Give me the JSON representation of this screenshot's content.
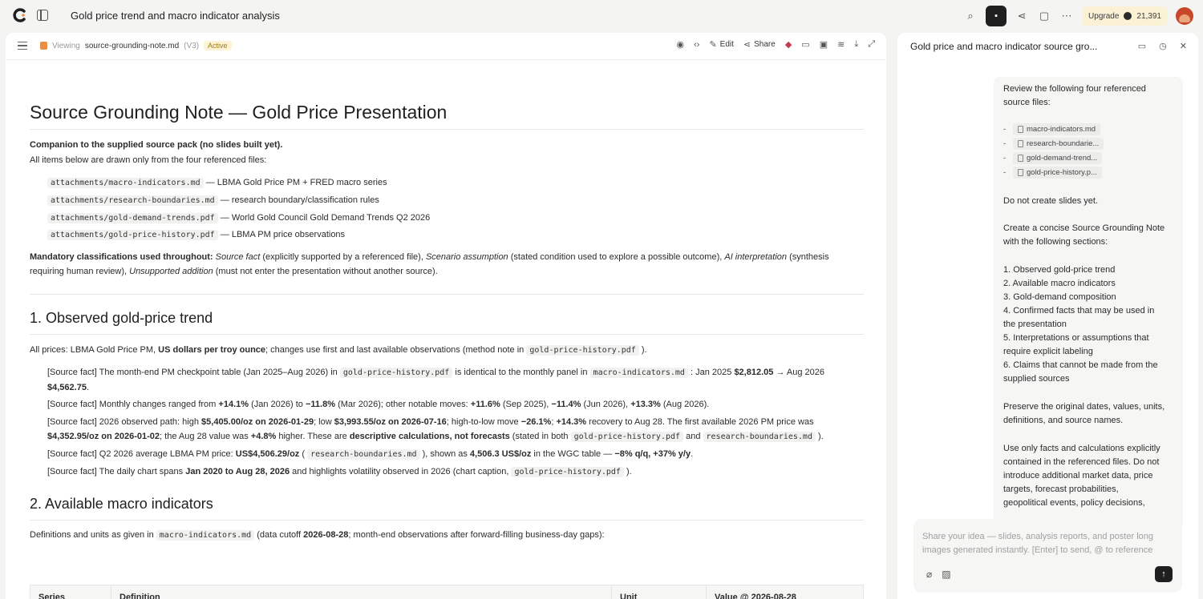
{
  "app": {
    "title": "Gold price trend and macro indicator analysis",
    "upgrade_label": "Upgrade",
    "credits": "21,391"
  },
  "doc_toolbar": {
    "viewing_label": "Viewing",
    "filename": "source-grounding-note.md",
    "version": "(V3)",
    "status": "Active",
    "edit_label": "Edit",
    "share_label": "Share"
  },
  "doc": {
    "title": "Source Grounding Note — Gold Price Presentation",
    "companion": "Companion to the supplied source pack (no slides built yet).",
    "intro": "All items below are drawn only from the four referenced files:",
    "files": [
      {
        "path": "attachments/macro-indicators.md",
        "desc": "— LBMA Gold Price PM + FRED macro series"
      },
      {
        "path": "attachments/research-boundaries.md",
        "desc": "— research boundary/classification rules"
      },
      {
        "path": "attachments/gold-demand-trends.pdf",
        "desc": "— World Gold Council Gold Demand Trends Q2 2026"
      },
      {
        "path": "attachments/gold-price-history.pdf",
        "desc": "— LBMA PM price observations"
      }
    ],
    "mandatory_label": "Mandatory classifications used throughout:",
    "mandatory": {
      "sf": "Source fact",
      "sf_desc": "(explicitly supported by a referenced file),",
      "sa": "Scenario assumption",
      "sa_desc": "(stated condition used to explore a possible outcome),",
      "ai": "AI interpretation",
      "ai_desc": "(synthesis requiring human review),",
      "ua": "Unsupported addition",
      "ua_desc": "(must not enter the presentation without another source)."
    },
    "s1": {
      "heading": "1. Observed gold-price trend",
      "intro_a": "All prices: LBMA Gold Price PM,",
      "intro_b": "US dollars per troy ounce",
      "intro_c": "; changes use first and last available observations (method note in",
      "intro_code": "gold-price-history.pdf",
      "intro_d": ").",
      "b1_a": "[Source fact] The month-end PM checkpoint table (Jan 2025–Aug 2026) in",
      "b1_code1": "gold-price-history.pdf",
      "b1_b": "is identical to the monthly panel in",
      "b1_code2": "macro-indicators.md",
      "b1_c": ": Jan 2025",
      "b1_v1": "$2,812.05",
      "b1_d": "→ Aug 2026",
      "b1_v2": "$4,562.75",
      "b1_e": ".",
      "b2_a": "[Source fact] Monthly changes ranged from",
      "b2_v1": "+14.1%",
      "b2_b": "(Jan 2026) to",
      "b2_v2": "−11.8%",
      "b2_c": "(Mar 2026); other notable moves:",
      "b2_v3": "+11.6%",
      "b2_d": "(Sep 2025),",
      "b2_v4": "−11.4%",
      "b2_e": "(Jun 2026),",
      "b2_v5": "+13.3%",
      "b2_f": "(Aug 2026).",
      "b3_a": "[Source fact] 2026 observed path: high",
      "b3_v1": "$5,405.00/oz on 2026-01-29",
      "b3_b": "; low",
      "b3_v2": "$3,993.55/oz on 2026-07-16",
      "b3_c": "; high-to-low move",
      "b3_v3": "−26.1%",
      "b3_d": ";",
      "b3_v4": "+14.3%",
      "b3_e": "recovery to Aug 28. The first available 2026 PM price was",
      "b3_v5": "$4,352.95/oz on 2026-01-02",
      "b3_f": "; the Aug 28 value was",
      "b3_v6": "+4.8%",
      "b3_g": "higher. These are",
      "b3_v7": "descriptive calculations, not forecasts",
      "b3_h": "(stated in both",
      "b3_code1": "gold-price-history.pdf",
      "b3_i": "and",
      "b3_code2": "research-boundaries.md",
      "b3_j": ").",
      "b4_a": "[Source fact] Q2 2026 average LBMA PM price:",
      "b4_v1": "US$4,506.29/oz",
      "b4_b": "(",
      "b4_code": "research-boundaries.md",
      "b4_c": "), shown as",
      "b4_v2": "4,506.3 US$/oz",
      "b4_d": "in the WGC table —",
      "b4_v3": "−8% q/q, +37% y/y",
      "b4_e": ".",
      "b5_a": "[Source fact] The daily chart spans",
      "b5_v1": "Jan 2020 to Aug 28, 2026",
      "b5_b": "and highlights volatility observed in 2026 (chart caption,",
      "b5_code": "gold-price-history.pdf",
      "b5_c": ")."
    },
    "s2": {
      "heading": "2. Available macro indicators",
      "intro_a": "Definitions and units as given in",
      "intro_code": "macro-indicators.md",
      "intro_b": "(data cutoff",
      "intro_v": "2026-08-28",
      "intro_c": "; month-end observations after forward-filling business-day gaps):",
      "columns": [
        "Series",
        "Definition",
        "Unit",
        "Value @ 2026-08-28"
      ]
    }
  },
  "chat": {
    "title": "Gold price and macro indicator source gro...",
    "lines": [
      "Review the following four referenced",
      "source files:"
    ],
    "chips": [
      "macro-indicators.md",
      "research-boundarie...",
      "gold-demand-trend...",
      "gold-price-history.p..."
    ],
    "p2": "Do not create slides yet.",
    "p3": [
      "Create a concise Source Grounding Note",
      "with the following sections:"
    ],
    "sections": [
      "1. Observed gold-price trend",
      "2. Available macro indicators",
      "3. Gold-demand composition",
      "4. Confirmed facts that may be used in",
      "the presentation",
      "5. Interpretations or assumptions that",
      "require explicit labeling",
      "6. Claims that cannot be made from the",
      "supplied sources"
    ],
    "p5": [
      "Preserve the original dates, values, units,",
      "definitions, and source names."
    ],
    "p6": [
      "Use only facts and calculations explicitly",
      "contained in the referenced files. Do not",
      "introduce additional market data, price",
      "targets, forecast probabilities,",
      "geopolitical events, policy decisions,"
    ],
    "input_placeholder": "Share your idea — slides, analysis reports, and poster long images generated instantly. [Enter] to send, @ to reference"
  }
}
